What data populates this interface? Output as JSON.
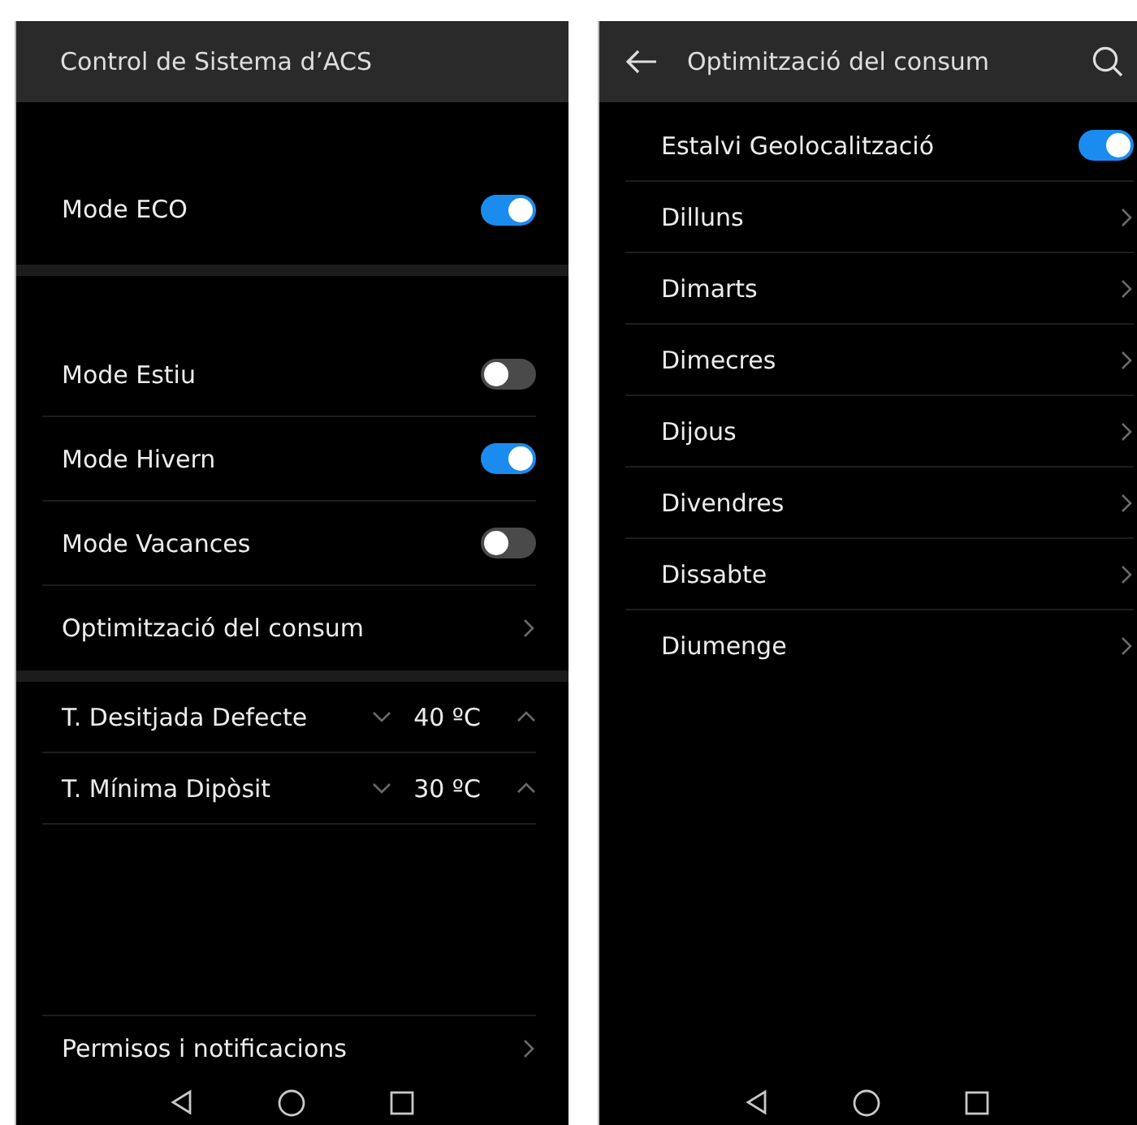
{
  "settings_screen": {
    "title": "Control de Sistema d’ACS",
    "eco": [
      {
        "kind": "toggle",
        "label": "Mode ECO",
        "on": true
      }
    ],
    "modes": [
      {
        "kind": "toggle",
        "label": "Mode Estiu",
        "on": false
      },
      {
        "kind": "toggle",
        "label": "Mode Hivern",
        "on": true
      },
      {
        "kind": "toggle",
        "label": "Mode Vacances",
        "on": false
      },
      {
        "kind": "link",
        "label": "Optimització del consum"
      }
    ],
    "temperatures": [
      {
        "label": "T. Desitjada Defecte",
        "value": "40 ºC"
      },
      {
        "label": "T. Mínima Dipòsit",
        "value": "30 ºC"
      }
    ],
    "footer": [
      {
        "kind": "link",
        "label": "Permisos i notificacions"
      }
    ]
  },
  "consumption_screen": {
    "title": "Optimització del consum",
    "items": [
      {
        "kind": "toggle",
        "label": "Estalvi Geolocalització",
        "on": true
      },
      {
        "kind": "link",
        "label": "Dilluns"
      },
      {
        "kind": "link",
        "label": "Dimarts"
      },
      {
        "kind": "link",
        "label": "Dimecres"
      },
      {
        "kind": "link",
        "label": "Dijous"
      },
      {
        "kind": "link",
        "label": "Divendres"
      },
      {
        "kind": "link",
        "label": "Dissabte"
      },
      {
        "kind": "link",
        "label": "Diumenge"
      }
    ]
  }
}
